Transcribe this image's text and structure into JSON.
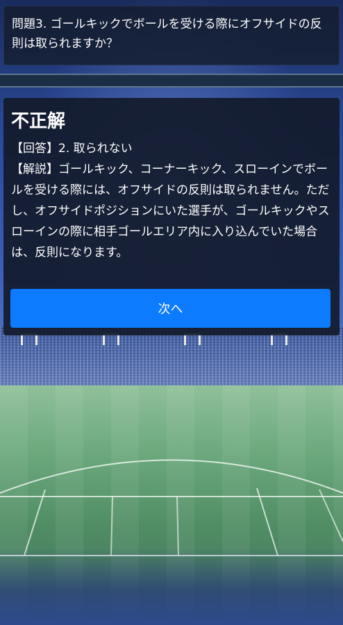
{
  "quiz": {
    "question": "問題3. ゴールキックでボールを受ける際にオフサイドの反則は取られますか？"
  },
  "result": {
    "title": "不正解",
    "answer": "【回答】2. 取られない",
    "explanation": "【解説】ゴールキック、コーナーキック、スローインでボールを受ける際には、オフサイドの反則は取られません。ただし、オフサイドポジションにいた選手が、ゴールキックやスローインの際に相手ゴールエリア内に入り込んでいた場合は、反則になります。",
    "next_label": "次へ"
  },
  "colors": {
    "accent": "#0d7bff",
    "panel": "#121a2a",
    "text": "#ffffff"
  }
}
